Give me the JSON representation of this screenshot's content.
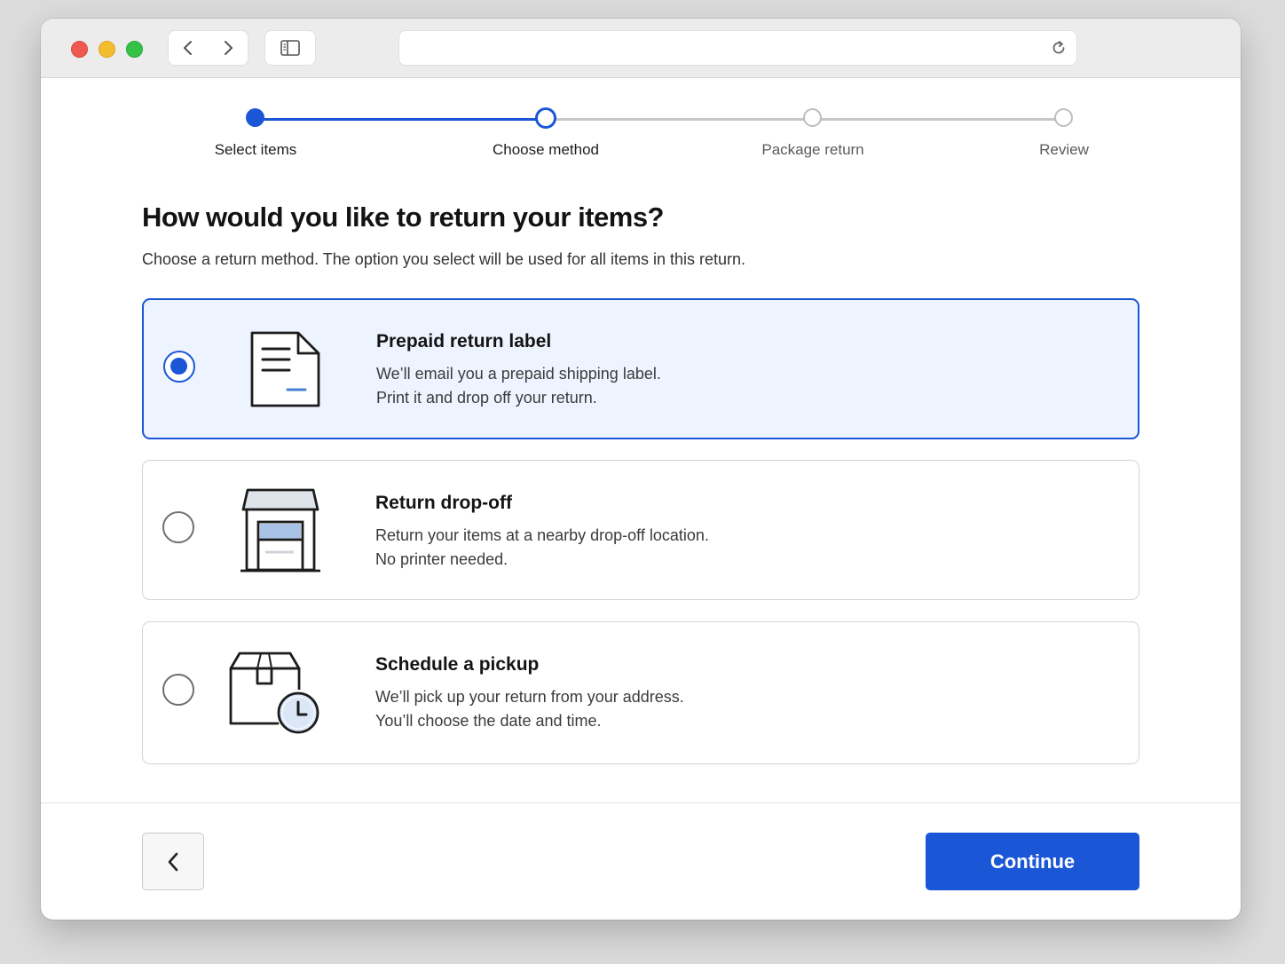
{
  "browser": {
    "address": "",
    "icons": [
      "back-icon",
      "forward-icon",
      "sidebar-icon",
      "reload-icon"
    ]
  },
  "stepper": {
    "steps": [
      {
        "label": "Select items",
        "state": "done"
      },
      {
        "label": "Choose method",
        "state": "current"
      },
      {
        "label": "Package return",
        "state": "upcoming"
      },
      {
        "label": "Review",
        "state": "upcoming"
      }
    ]
  },
  "page": {
    "title": "How would you like to return your items?",
    "subtitle": "Choose a return method. The option you select will be used for all items in this return."
  },
  "options": [
    {
      "title": "Prepaid return label",
      "line1": "We’ll email you a prepaid shipping label.",
      "line2": "Print it and drop off your return.",
      "icon": "document-label-icon",
      "selected": true
    },
    {
      "title": "Return drop-off",
      "line1": "Return your items at a nearby drop-off location.",
      "line2": "No printer needed.",
      "icon": "store-dropoff-icon",
      "selected": false
    },
    {
      "title": "Schedule a pickup",
      "line1": "We’ll pick up your return from your address.",
      "line2": "You’ll choose the date and time.",
      "icon": "box-clock-icon",
      "selected": false
    }
  ],
  "footer": {
    "back_icon": "chevron-left-icon",
    "continue_label": "Continue"
  },
  "colors": {
    "accent": "#1a56d6",
    "selected_background": "#eef4ff",
    "inactive_step": "#c8c8c8"
  }
}
